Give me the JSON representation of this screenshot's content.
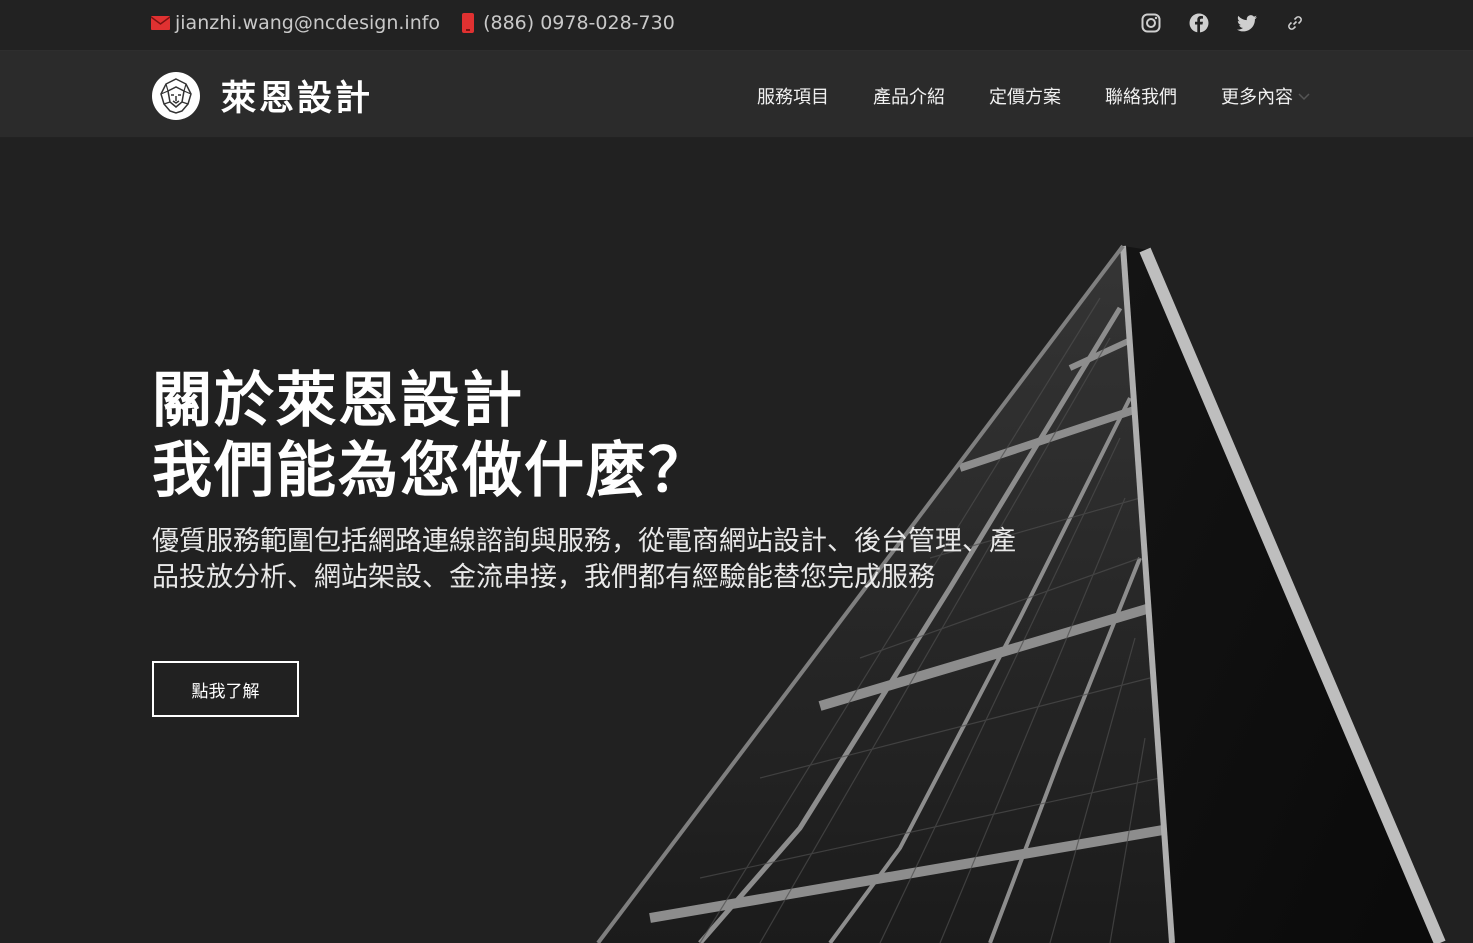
{
  "topbar": {
    "email": "jianzhi.wang@ncdesign.info",
    "phone": "(886) 0978-028-730",
    "social_icons": [
      "instagram-icon",
      "facebook-icon",
      "twitter-icon",
      "link-icon"
    ]
  },
  "brand": {
    "name": "萊恩設計",
    "logo_icon": "lion-logo-icon"
  },
  "nav": {
    "items": [
      "服務項目",
      "產品介紹",
      "定價方案",
      "聯絡我們"
    ],
    "more_label": "更多內容"
  },
  "hero": {
    "title_line1": "關於萊恩設計",
    "title_line2": "我們能為您做什麼？",
    "description": "優質服務範圍包括網路連線諮詢與服務，從電商網站設計、後台管理、產品投放分析、網站架設、金流串接，我們都有經驗能替您完成服務",
    "cta_label": "點我了解"
  },
  "colors": {
    "background": "#222222",
    "navbar": "#2b2b2b",
    "email_icon": "#e03131",
    "phone_icon": "#e03131",
    "text": "#ffffff"
  }
}
